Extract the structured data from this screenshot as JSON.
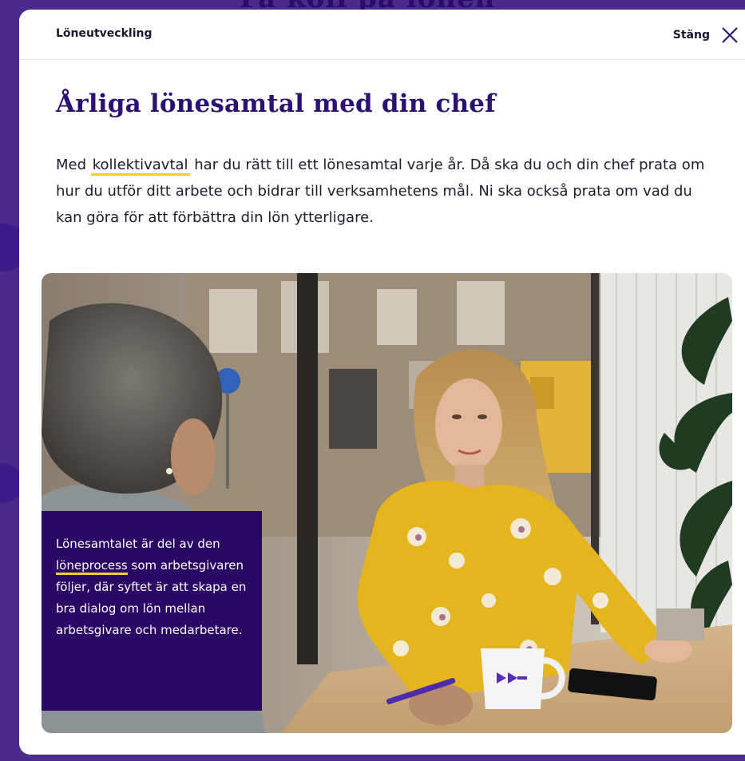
{
  "background": {
    "title": "Få koll på lönen"
  },
  "modal": {
    "breadcrumb": "Löneutveckling",
    "close_label": "Stäng",
    "close_icon": "close-icon",
    "title": "Årliga lönesamtal med din chef",
    "intro": {
      "before_link": "Med ",
      "link_text": "kollektivavtal",
      "after_link": " har du rätt till ett lönesamtal varje år. Då ska du och din chef prata om hur du utför ditt arbete och bidrar till verksamhetens mål. Ni ska också prata om vad du kan göra för att förbättra din lön ytterligare."
    },
    "caption": {
      "before_link": "Lönesamtalet är del av den ",
      "link_text": "löneprocess",
      "after_link": " som arbetsgivaren följer, där syftet är att skapa en bra dialog om lön mellan arbetsgivare och medarbetare."
    }
  },
  "colors": {
    "accent_purple": "#2e0f74",
    "caption_bg": "#2b0766",
    "link_underline": "#f6cf2f",
    "backdrop": "#4a2a8a"
  }
}
